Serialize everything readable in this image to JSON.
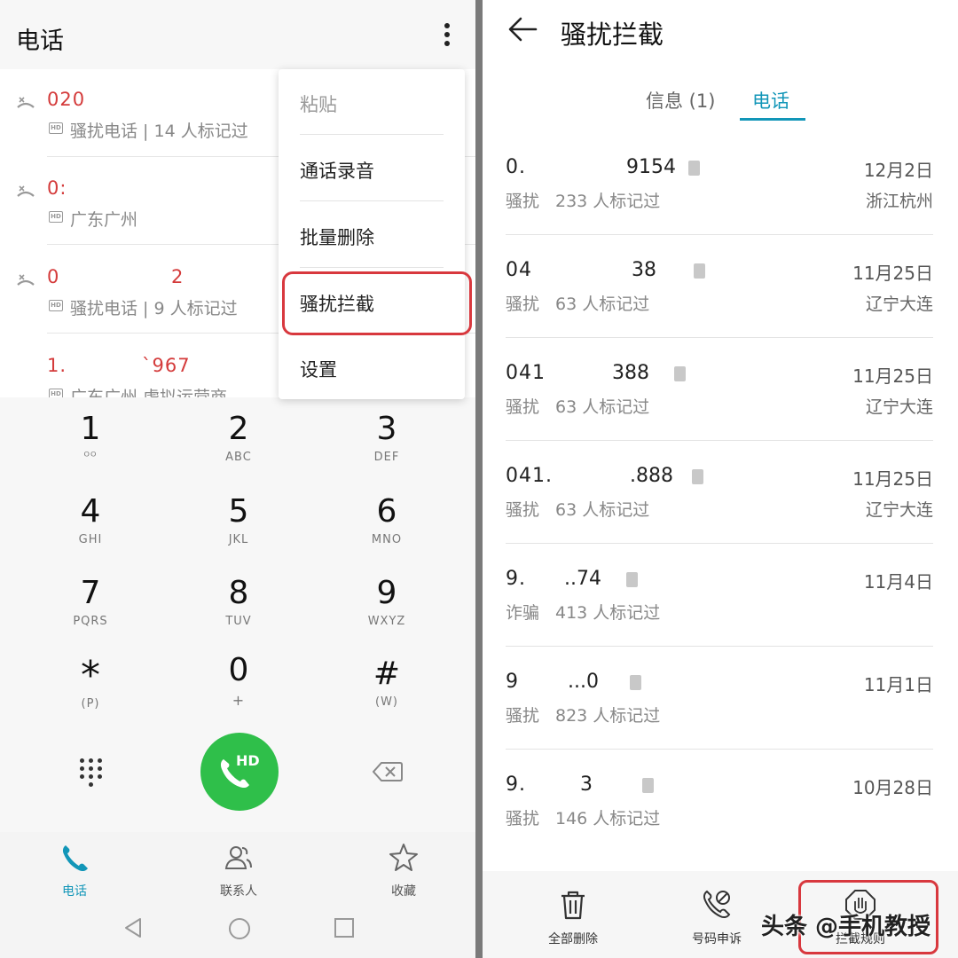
{
  "left": {
    "title": "电话",
    "calls": [
      {
        "number": "020",
        "number_tail": "",
        "hd": "HD",
        "subtitle": "骚扰电话 | 14 人标记过"
      },
      {
        "number": "0:",
        "number_tail": "",
        "hd": "HD",
        "subtitle": "广东广州"
      },
      {
        "number": "0",
        "number_tail": "2",
        "hd": "HD",
        "subtitle": "骚扰电话 | 9 人标记过"
      },
      {
        "number": "1.",
        "number_tail": "`967",
        "hd": "HD",
        "subtitle": "广东广州 虚拟运营商"
      }
    ],
    "menu": {
      "items": [
        "粘贴",
        "通话录音",
        "批量删除",
        "骚扰拦截",
        "设置"
      ]
    },
    "keypad": [
      {
        "digit": "1",
        "letters": "ᴼᴼ"
      },
      {
        "digit": "2",
        "letters": "ABC"
      },
      {
        "digit": "3",
        "letters": "DEF"
      },
      {
        "digit": "4",
        "letters": "GHI"
      },
      {
        "digit": "5",
        "letters": "JKL"
      },
      {
        "digit": "6",
        "letters": "MNO"
      },
      {
        "digit": "7",
        "letters": "PQRS"
      },
      {
        "digit": "8",
        "letters": "TUV"
      },
      {
        "digit": "9",
        "letters": "WXYZ"
      },
      {
        "digit": "*",
        "letters": "(P)"
      },
      {
        "digit": "0",
        "letters": "+"
      },
      {
        "digit": "#",
        "letters": "(W)"
      }
    ],
    "call_button_label": "HD",
    "nav": [
      {
        "label": "电话",
        "icon": "phone-icon",
        "active": true
      },
      {
        "label": "联系人",
        "icon": "contacts-icon",
        "active": false
      },
      {
        "label": "收藏",
        "icon": "star-icon",
        "active": false
      }
    ]
  },
  "right": {
    "title": "骚扰拦截",
    "tabs": [
      "信息 (1)",
      "电话"
    ],
    "rows": [
      {
        "num": "0.",
        "tail": "9154",
        "date": "12月2日",
        "tag": "骚扰",
        "count": "233 人标记过",
        "location": "浙江杭州"
      },
      {
        "num": "04",
        "tail": "38",
        "date": "11月25日",
        "tag": "骚扰",
        "count": "63 人标记过",
        "location": "辽宁大连"
      },
      {
        "num": "041",
        "tail": "388",
        "date": "11月25日",
        "tag": "骚扰",
        "count": "63 人标记过",
        "location": "辽宁大连"
      },
      {
        "num": "041.",
        "tail": ".888",
        "date": "11月25日",
        "tag": "骚扰",
        "count": "63 人标记过",
        "location": "辽宁大连"
      },
      {
        "num": "9.",
        "tail": "..74",
        "date": "11月4日",
        "tag": "诈骗",
        "count": "413 人标记过",
        "location": ""
      },
      {
        "num": "9",
        "tail": "...0",
        "date": "11月1日",
        "tag": "骚扰",
        "count": "823 人标记过",
        "location": ""
      },
      {
        "num": "9.",
        "tail": "3",
        "date": "10月28日",
        "tag": "骚扰",
        "count": "146 人标记过",
        "location": ""
      }
    ],
    "bottom": [
      {
        "label": "全部删除",
        "icon": "trash-icon"
      },
      {
        "label": "号码申诉",
        "icon": "phone-appeal-icon"
      },
      {
        "label": "拦截规则",
        "icon": "block-rules-icon"
      }
    ],
    "watermark": "头条 @手机教授"
  },
  "colors": {
    "accent": "#1296b8",
    "missed": "#d43b3b",
    "highlight": "#d8383e",
    "call_green": "#2fbf4a"
  }
}
